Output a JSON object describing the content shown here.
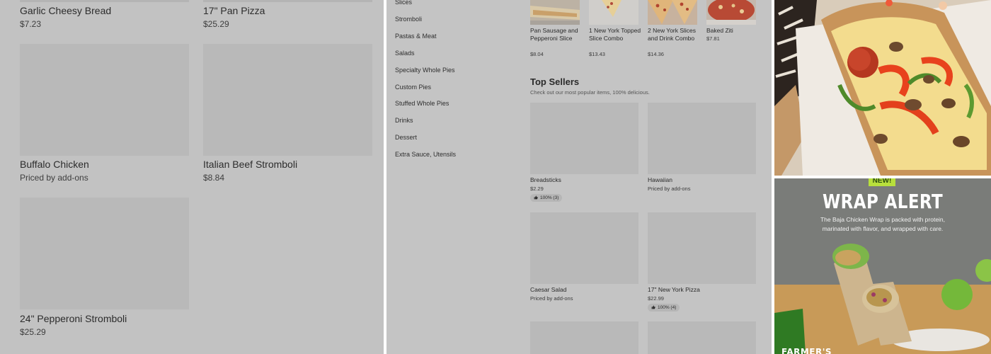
{
  "left_menu": {
    "items": [
      {
        "name": "Garlic Cheesy Bread",
        "price": "$7.23"
      },
      {
        "name": "17\" Pan Pizza",
        "price": "$25.29"
      },
      {
        "name": "Buffalo Chicken",
        "price": "Priced by add-ons"
      },
      {
        "name": "Italian Beef Stromboli",
        "price": "$8.84"
      },
      {
        "name": "24\" Pepperoni Stromboli",
        "price": "$25.29"
      }
    ]
  },
  "category_nav": {
    "items": [
      "Slices",
      "Stromboli",
      "Pastas & Meat",
      "Salads",
      "Specialty Whole Pies",
      "Custom Pies",
      "Stuffed Whole Pies",
      "Drinks",
      "Dessert",
      "Extra Sauce, Utensils"
    ]
  },
  "featured_row": [
    {
      "name": "Pan Sausage and Pepperoni Slice",
      "price": "$8.04"
    },
    {
      "name": "1 New York Topped Slice Combo",
      "price": "$13.43"
    },
    {
      "name": "2 New York Slices and Drink Combo",
      "price": "$14.36"
    },
    {
      "name": "Baked Ziti",
      "price": "$7.81"
    }
  ],
  "top_sellers": {
    "title": "Top Sellers",
    "subtitle": "Check out our most popular items, 100% delicious.",
    "items": [
      {
        "name": "Breadsticks",
        "price": "$2.29",
        "rating": "100% (3)"
      },
      {
        "name": "Hawaiian",
        "price": "Priced by add-ons",
        "rating": ""
      },
      {
        "name": "Caesar Salad",
        "price": "Priced by add-ons",
        "rating": ""
      },
      {
        "name": "17\" New York Pizza",
        "price": "$22.99",
        "rating": "100% (4)"
      }
    ]
  },
  "promo": {
    "badge": "NEW!",
    "headline": "WRAP ALERT",
    "body": "The Baja Chicken Wrap is packed with protein, marinated with flavor, and wrapped with care.",
    "brand": "FARMER'S"
  },
  "colors": {
    "overlay_gray": "#c2c2c2",
    "placeholder_gray": "#b9b9b9",
    "promo_green": "#2f7a23",
    "badge_green": "#b8e03c"
  }
}
